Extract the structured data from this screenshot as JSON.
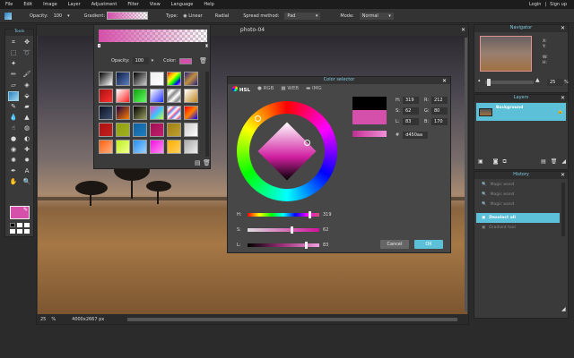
{
  "menu": {
    "items": [
      "File",
      "Edit",
      "Image",
      "Layer",
      "Adjustment",
      "Filter",
      "View",
      "Language",
      "Help"
    ],
    "login": "Login",
    "separator": "|",
    "signup": "Sign up"
  },
  "toolbar": {
    "opacity_label": "Opacity:",
    "opacity_value": "100",
    "gradient_label": "Gradient:",
    "type_label": "Type:",
    "type_linear": "Linear",
    "type_radial": "Radial",
    "spread_label": "Spread method:",
    "spread_value": "Pad",
    "mode_label": "Mode:",
    "mode_value": "Normal"
  },
  "tools": {
    "title": "Tools",
    "icons": [
      "crop",
      "move",
      "marquee",
      "lasso",
      "wand",
      "pencil",
      "brush",
      "eraser",
      "fill-bucket",
      "gradient",
      "clone-stamp",
      "color-replace",
      "blob",
      "blur",
      "sharpen",
      "smudge",
      "sponge",
      "burn",
      "dodge",
      "red-eye",
      "spot-heal",
      "bloat",
      "pinch",
      "color-picker",
      "type",
      "hand",
      "zoom"
    ]
  },
  "gradient_panel": {
    "opacity_label": "Opacity:",
    "opacity_value": "100",
    "color_label": "Color:",
    "color": "#d450aa",
    "swatches": [
      "linear-gradient(135deg,#000,#fff)",
      "linear-gradient(135deg,#0a1a40,#6080c0)",
      "linear-gradient(135deg,#000,#ccc)",
      "linear-gradient(135deg,#eee,#fff)",
      "linear-gradient(135deg,red,orange,yellow,lime,blue,violet)",
      "linear-gradient(135deg,#2a2080,#c09040,#2a2080)",
      "linear-gradient(135deg,#aa1010,#ff3030)",
      "linear-gradient(135deg,#fff,#ff2020)",
      "linear-gradient(135deg,#10a010,#60ff60)",
      "linear-gradient(135deg,#fff,#2030ff)",
      "repeating-linear-gradient(135deg,#888,#fff 4px,#888 8px)",
      "linear-gradient(135deg,#fff,#c08820)",
      "linear-gradient(135deg,#0a1020,#405070)",
      "linear-gradient(135deg,#200040,#ff8000)",
      "linear-gradient(135deg,#000,#9aa060)",
      "linear-gradient(135deg,#ff40c0,#40c0ff,#c0ff40)",
      "repeating-linear-gradient(135deg,#6080ff,#fff 3px,#ff4060 6px)",
      "linear-gradient(135deg,#ff0000,#ff8000,#0000ff)",
      "linear-gradient(135deg,#b01010,#c02020)",
      "linear-gradient(135deg,#90a010,#a0b020)",
      "linear-gradient(135deg,#1060a0,#2080c0)",
      "linear-gradient(135deg,#a01050,#c02070)",
      "linear-gradient(135deg,#a08010,#c0a030)",
      "linear-gradient(135deg,#ccc,#fff)",
      "linear-gradient(135deg,#ff6010,#ffb080)",
      "linear-gradient(135deg,#c0f020,#f0ff90)",
      "linear-gradient(135deg,#2090f0,#a0d0ff)",
      "linear-gradient(135deg,#f010e0,#ff90f0)",
      "linear-gradient(135deg,#ffb000,#ffd060)",
      "linear-gradient(135deg,#aaa,#eee)"
    ]
  },
  "image_window": {
    "title": "photo-04",
    "zoom": "25",
    "zoom_unit": "%",
    "dimensions": "4000x2667 px"
  },
  "color_selector": {
    "title": "Color selector",
    "tabs": [
      "HSL",
      "RGB",
      "WEB",
      "IMG"
    ],
    "H_label": "H:",
    "H": "319",
    "S_label": "S:",
    "S": "62",
    "L_label": "L:",
    "L": "83",
    "R_label": "R:",
    "R": "212",
    "G_label": "G:",
    "G": "80",
    "B_label": "B:",
    "B": "170",
    "hash": "#",
    "hex": "d450aa",
    "old_color": "#000000",
    "new_color": "#d450aa",
    "cancel": "Cancel",
    "ok": "OK",
    "h_frac": 0.886,
    "s_frac": 0.62,
    "l_frac": 0.83
  },
  "navigator": {
    "title": "Navigator",
    "x_label": "X:",
    "y_label": "Y:",
    "w_label": "W:",
    "h_label": "H:",
    "zoom": "25",
    "unit": "%"
  },
  "layers": {
    "title": "Layers",
    "items": [
      {
        "name": "Background"
      }
    ]
  },
  "history": {
    "title": "History",
    "items": [
      "Magic wand",
      "Magic wand",
      "Magic wand",
      "Deselect all",
      "Gradient tool"
    ],
    "selected": 3
  },
  "colors": {
    "accent": "#5bc0d8",
    "pink": "#d450aa"
  }
}
